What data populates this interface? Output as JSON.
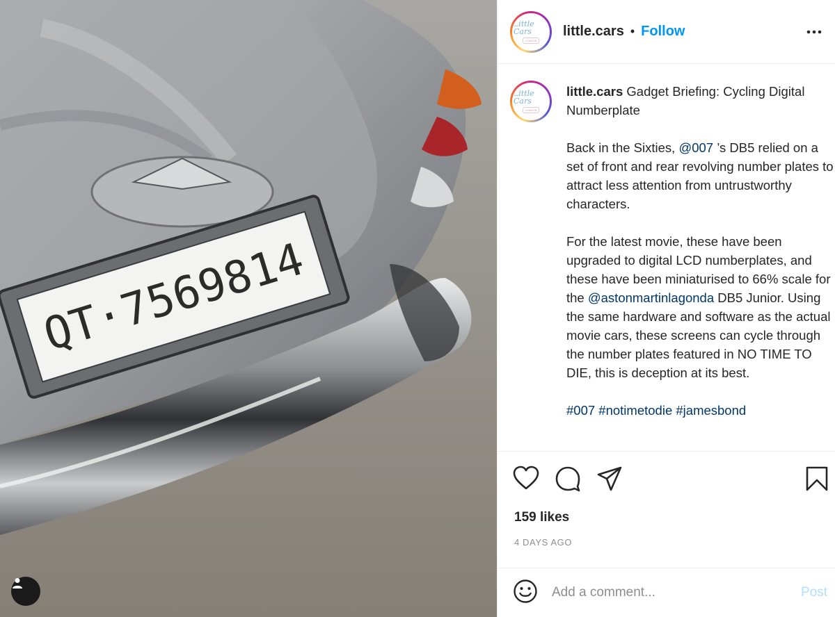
{
  "photo": {
    "plate_text": "QT·7569814",
    "icons": {
      "tag_button": "user-tag-icon"
    }
  },
  "post": {
    "username": "little.cars",
    "follow_label": "Follow",
    "separator": "•",
    "avatar": {
      "logo_text": "Little Cars",
      "sub_text": "LONDON"
    },
    "caption": {
      "username": "little.cars",
      "title": " Gadget Briefing: Cycling Digital Numberplate",
      "p1_before": "Back in the Sixties, ",
      "p1_mention": "@007",
      "p1_after": " ’s DB5 relied on a set of front and rear revolving number plates to attract less attention from untrustworthy characters.",
      "p2_before": "For the latest movie, these have been upgraded to digital LCD numberplates, and these have been miniaturised to 66% scale for the ",
      "p2_mention": "@astonmartinlagonda",
      "p2_after": " DB5 Junior. Using the same hardware and software as the actual movie cars, these screens can cycle through the number plates featured in NO TIME TO DIE, this is deception at its best.",
      "hashtags": [
        "#007",
        "#notimetodie",
        "#jamesbond"
      ]
    },
    "likes": "159 likes",
    "date": "4 DAYS AGO",
    "comment": {
      "placeholder": "Add a comment...",
      "post_label": "Post"
    },
    "icons": {
      "more": "more-options-icon",
      "like": "heart-icon",
      "comment": "comment-icon",
      "share": "share-icon",
      "save": "bookmark-icon",
      "emoji": "emoji-icon"
    },
    "colors": {
      "link": "#0095f6",
      "mention": "#00376b",
      "post_disabled": "#b2dffc",
      "muted": "#8e8e8e"
    }
  }
}
